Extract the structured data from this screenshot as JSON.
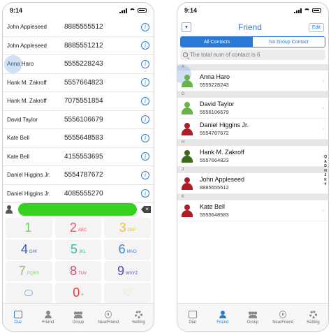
{
  "left": {
    "status_time": "9:14",
    "contacts": [
      {
        "name": "John Appleseed",
        "number": "8885555512"
      },
      {
        "name": "John Appleseed",
        "number": "8885551212"
      },
      {
        "name": "Anna Haro",
        "number": "5555228243"
      },
      {
        "name": "Hank M. Zakroff",
        "number": "5557664823"
      },
      {
        "name": "Hank M. Zakroff",
        "number": "7075551854"
      },
      {
        "name": "David Taylor",
        "number": "5556106679"
      },
      {
        "name": "Kate Bell",
        "number": "5555648583"
      },
      {
        "name": "Kate Bell",
        "number": "4155553695"
      },
      {
        "name": "Daniel Higgins Jr.",
        "number": "5554787672"
      },
      {
        "name": "Daniel Higgins Jr.",
        "number": "4085555270"
      }
    ],
    "info_glyph": "i",
    "keypad": [
      {
        "digit": "1",
        "letters": ""
      },
      {
        "digit": "2",
        "letters": "ABC"
      },
      {
        "digit": "3",
        "letters": "DEF"
      },
      {
        "digit": "4",
        "letters": "GHI"
      },
      {
        "digit": "5",
        "letters": "JKL"
      },
      {
        "digit": "6",
        "letters": "MNO"
      },
      {
        "digit": "7",
        "letters": "PQRS"
      },
      {
        "digit": "8",
        "letters": "TUV"
      },
      {
        "digit": "9",
        "letters": "WXYZ"
      },
      {
        "digit": "",
        "letters": ""
      },
      {
        "digit": "0",
        "letters": "+"
      },
      {
        "digit": "",
        "letters": ""
      }
    ],
    "backspace_glyph": "✕",
    "tabs": [
      "Dial",
      "Friend",
      "Group",
      "NearFriend",
      "Setting"
    ],
    "active_tab": "Dial"
  },
  "right": {
    "status_time": "9:14",
    "nav_left_glyph": "▼",
    "title": "Friend",
    "edit_label": "Edit",
    "segments": [
      "All Contacts",
      "No Group Contact"
    ],
    "search_text": "The total num of contact is 6",
    "sections": [
      {
        "letter": "A",
        "contacts": [
          {
            "name": "Anna Haro",
            "phone": "5555228243",
            "color": "#6bb24a"
          }
        ]
      },
      {
        "letter": "D",
        "contacts": [
          {
            "name": "David Taylor",
            "phone": "5556106679",
            "color": "#6bb24a"
          },
          {
            "name": "Daniel Higgins Jr.",
            "phone": "5554787672",
            "color": "#b01c24"
          }
        ]
      },
      {
        "letter": "H",
        "contacts": [
          {
            "name": "Hank M. Zakroff",
            "phone": "5557664823",
            "color": "#3b6a1a"
          }
        ]
      },
      {
        "letter": "J",
        "contacts": [
          {
            "name": "John Appleseed",
            "phone": "8885555512",
            "color": "#b01c24"
          }
        ]
      },
      {
        "letter": "K",
        "contacts": [
          {
            "name": "Kate Bell",
            "phone": "5555648583",
            "color": "#b01c24"
          }
        ]
      }
    ],
    "chevron_glyph": "›",
    "index_letters": [
      "Q",
      "A",
      "D",
      "H",
      "J",
      "K",
      "#"
    ],
    "tabs": [
      "Dial",
      "Friend",
      "Group",
      "NearFriend",
      "Setting"
    ],
    "active_tab": "Friend"
  },
  "colors": {
    "accent": "#2a7ad5",
    "call_green": "#34d21f"
  }
}
